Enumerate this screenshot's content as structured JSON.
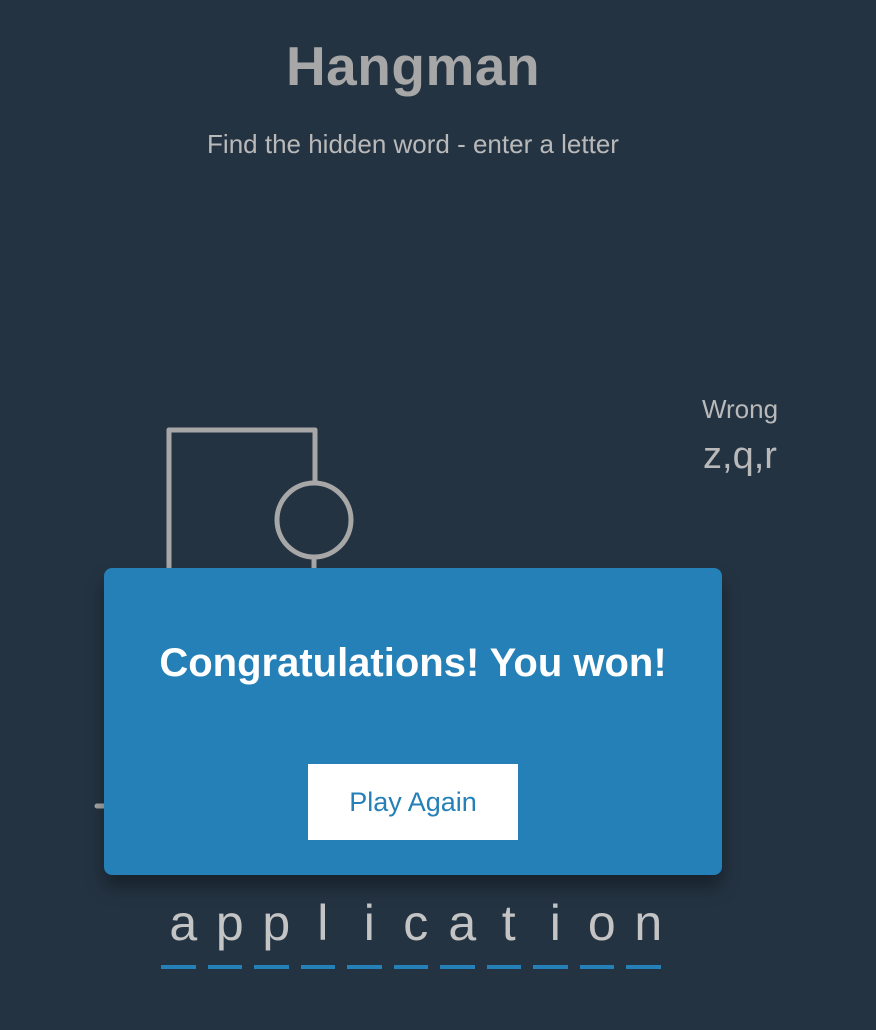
{
  "header": {
    "title": "Hangman",
    "subtitle": "Find the hidden word - enter a letter"
  },
  "wrong_letters": {
    "label": "Wrong",
    "letters": "z,q,r",
    "count": 3
  },
  "word": {
    "letters": [
      "a",
      "p",
      "p",
      "l",
      "i",
      "c",
      "a",
      "t",
      "i",
      "o",
      "n"
    ]
  },
  "popup": {
    "message": "Congratulations! You won!",
    "button_label": "Play Again"
  },
  "colors": {
    "background": "#243342",
    "accent": "#2580b8",
    "figure": "#a7a7a7",
    "text": "#c4c4c4"
  }
}
